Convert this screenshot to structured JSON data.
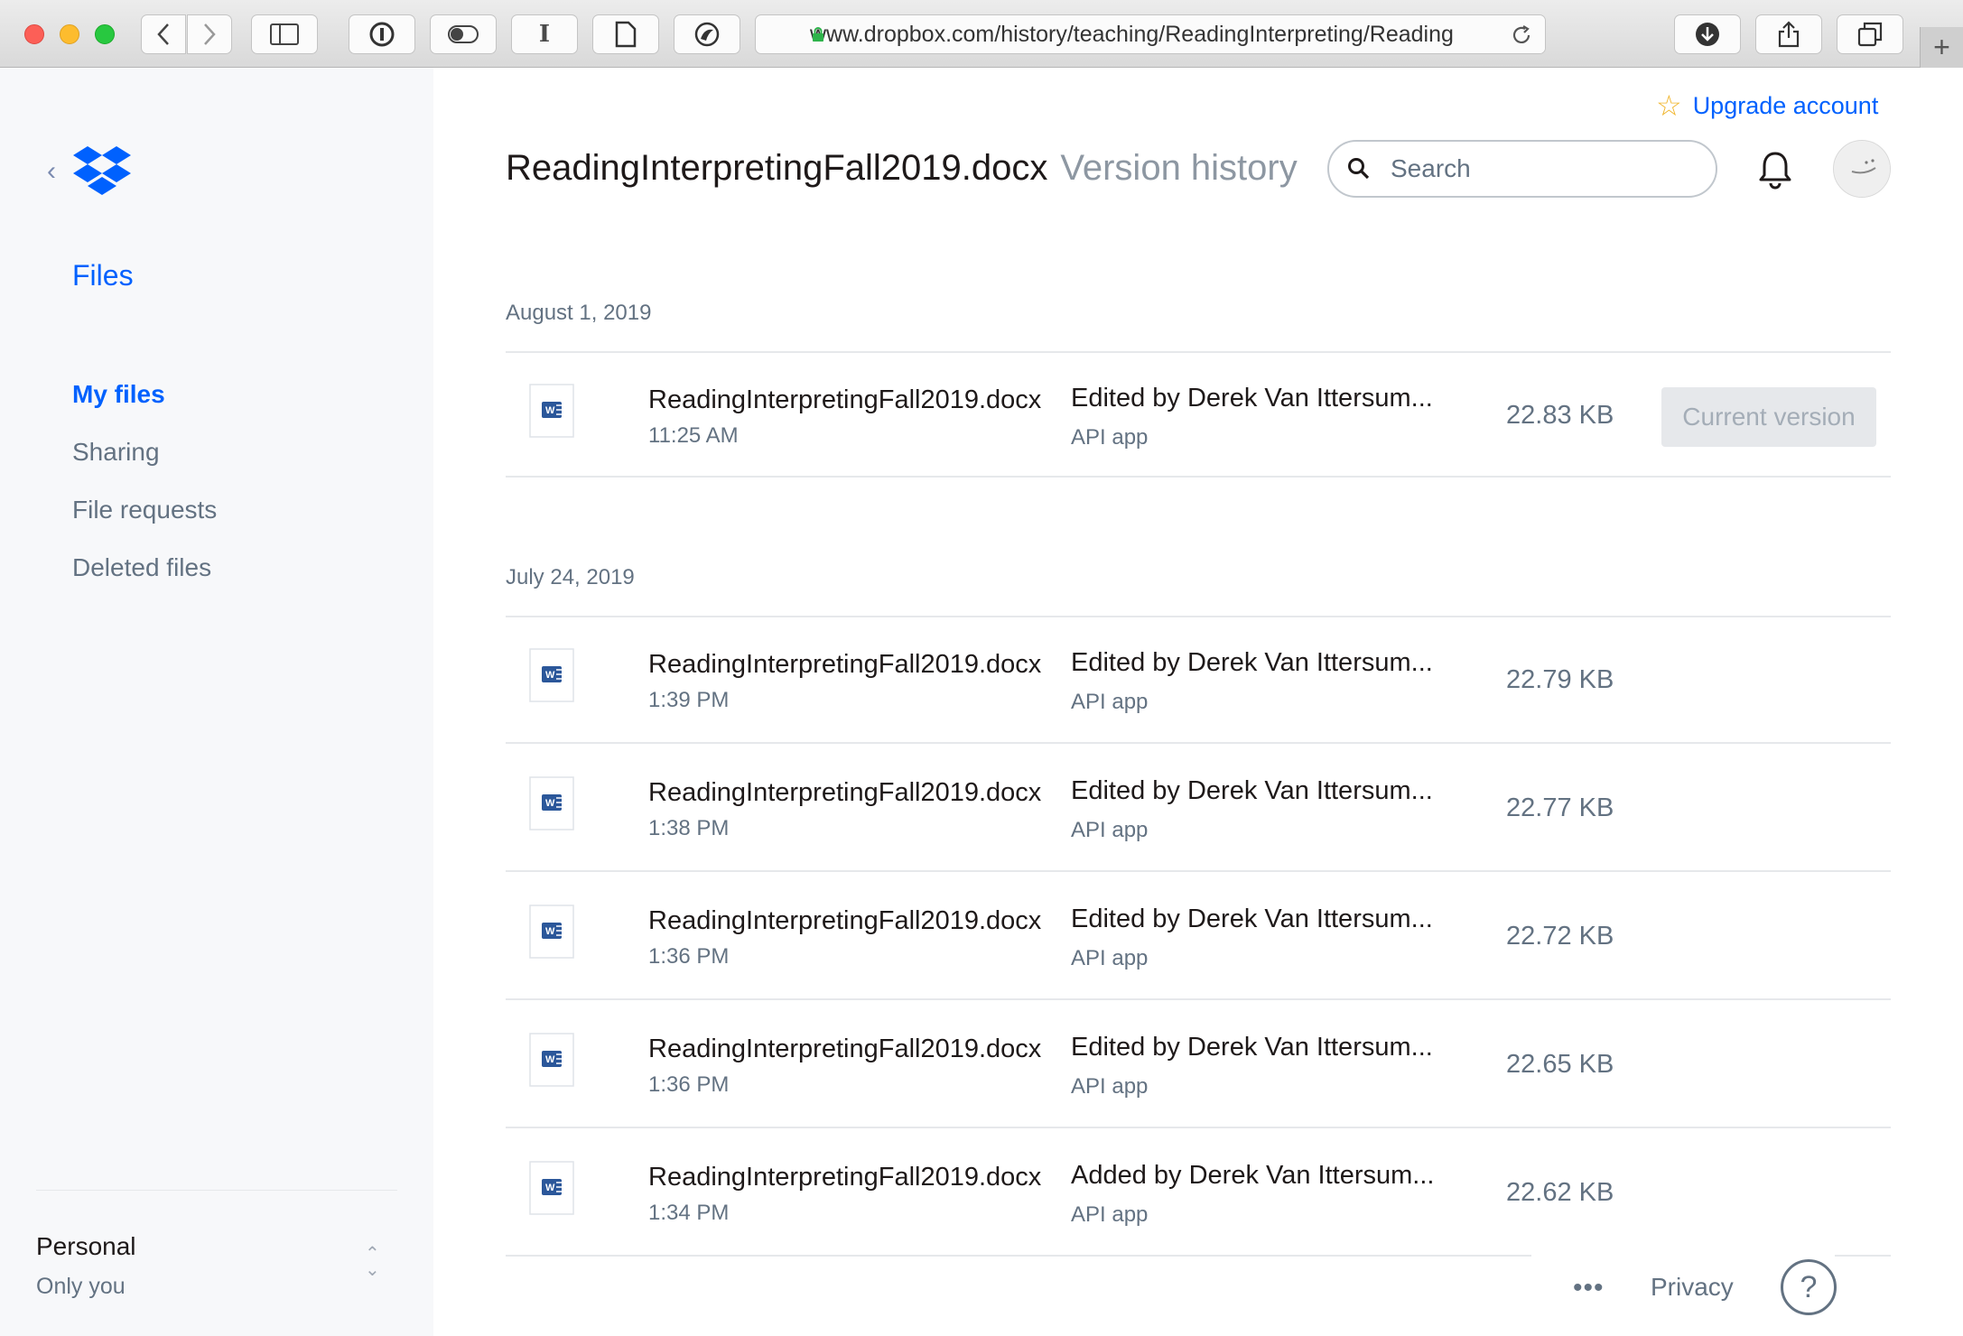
{
  "browser": {
    "url": "www.dropbox.com/history/teaching/ReadingInterpreting/Reading"
  },
  "sidebar": {
    "files_label": "Files",
    "nav": [
      {
        "label": "My files",
        "active": true
      },
      {
        "label": "Sharing",
        "active": false
      },
      {
        "label": "File requests",
        "active": false
      },
      {
        "label": "Deleted files",
        "active": false
      }
    ],
    "account": {
      "name": "Personal",
      "subtitle": "Only you"
    }
  },
  "header": {
    "upgrade_label": "Upgrade account",
    "file_title": "ReadingInterpretingFall2019.docx",
    "subtitle": "Version history",
    "search_placeholder": "Search"
  },
  "groups": [
    {
      "date": "August 1, 2019",
      "versions": [
        {
          "name": "ReadingInterpretingFall2019.docx",
          "time": "11:25 AM",
          "editor": "Edited by Derek Van Ittersum...",
          "app": "API app",
          "size": "22.83 KB",
          "badge": "Current version"
        }
      ]
    },
    {
      "date": "July 24, 2019",
      "versions": [
        {
          "name": "ReadingInterpretingFall2019.docx",
          "time": "1:39 PM",
          "editor": "Edited by Derek Van Ittersum...",
          "app": "API app",
          "size": "22.79 KB"
        },
        {
          "name": "ReadingInterpretingFall2019.docx",
          "time": "1:38 PM",
          "editor": "Edited by Derek Van Ittersum...",
          "app": "API app",
          "size": "22.77 KB"
        },
        {
          "name": "ReadingInterpretingFall2019.docx",
          "time": "1:36 PM",
          "editor": "Edited by Derek Van Ittersum...",
          "app": "API app",
          "size": "22.72 KB"
        },
        {
          "name": "ReadingInterpretingFall2019.docx",
          "time": "1:36 PM",
          "editor": "Edited by Derek Van Ittersum...",
          "app": "API app",
          "size": "22.65 KB"
        },
        {
          "name": "ReadingInterpretingFall2019.docx",
          "time": "1:34 PM",
          "editor": "Added by Derek Van Ittersum...",
          "app": "API app",
          "size": "22.62 KB"
        }
      ]
    }
  ],
  "footer": {
    "more_label": "•••",
    "privacy_label": "Privacy",
    "help_label": "?"
  },
  "colors": {
    "accent": "#0061fe",
    "muted": "#637282"
  }
}
